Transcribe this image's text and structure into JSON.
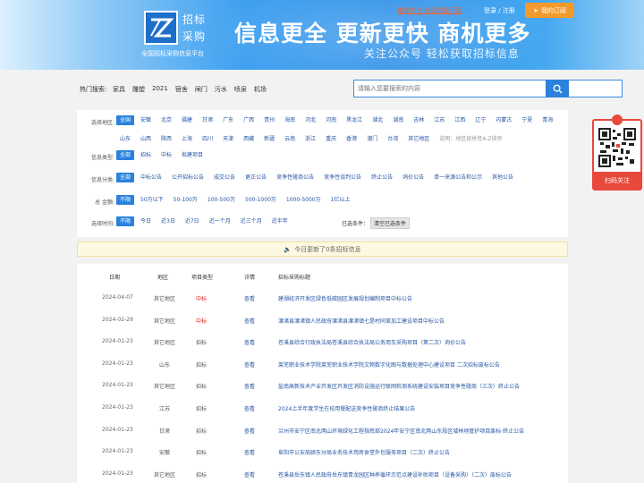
{
  "header": {
    "logo_line1": "招标",
    "logo_line2": "采购",
    "logo_sub": "全国招标采购信息平台",
    "headline": "信息更全  更新更快  商机更多",
    "subline": "关注公众号 轻松获取招标信息",
    "notice_link": "重点关注 全国招标订阅",
    "login": "登录 / 注册",
    "subscribe": "我的订阅",
    "colors": {
      "accent": "#2a82dd",
      "orange": "#f39a2c",
      "red": "#e02020"
    }
  },
  "search": {
    "hot_label": "热门搜索:",
    "hot_words": [
      "家具",
      "雕塑",
      "2021",
      "宿舍",
      "闸门",
      "污水",
      "喷泉",
      "机场"
    ],
    "placeholder": "请输入您要搜索的内容"
  },
  "filters": {
    "region": {
      "label": "选择地区:",
      "options": [
        "全国",
        "安徽",
        "北京",
        "福建",
        "甘肃",
        "广东",
        "广西",
        "贵州",
        "海南",
        "河北",
        "河南",
        "黑龙江",
        "湖北",
        "湖南",
        "吉林",
        "江苏",
        "江西",
        "辽宁",
        "内蒙古",
        "宁夏",
        "青海",
        "山东",
        "山西",
        "陕西",
        "上海",
        "四川",
        "天津",
        "西藏",
        "新疆",
        "云南",
        "浙江",
        "重庆",
        "香港",
        "澳门",
        "台湾",
        "其它地区"
      ],
      "note": "说明：地区按拼音A-Z排序"
    },
    "info_type": {
      "label": "信息类型:",
      "options": [
        "全部",
        "招标",
        "中标",
        "拟建项目"
      ]
    },
    "info_class": {
      "label": "信息分类:",
      "options": [
        "全部",
        "中标公告",
        "公开招标公告",
        "成交公告",
        "更正公告",
        "竞争性磋商公告",
        "竞争性谈判公告",
        "终止公告",
        "询价公告",
        "单一来源公告和公示",
        "其他公告"
      ]
    },
    "amount": {
      "label": "总 金额:",
      "options": [
        "不限",
        "50万以下",
        "50-100万",
        "100-500万",
        "500-1000万",
        "1000-5000万",
        "1亿以上"
      ]
    },
    "time": {
      "label": "选择时间:",
      "options": [
        "不限",
        "今日",
        "近3日",
        "近7日",
        "近一个月",
        "近三个月",
        "近半年"
      ]
    },
    "selected_label": "已选条件：",
    "clear": "清空已选条件"
  },
  "update_notice": "今日更新了0条招标信息",
  "table": {
    "headers": {
      "date": "日期",
      "area": "地区",
      "type": "项目类型",
      "detail": "详情",
      "title": "招标采购标题"
    },
    "rows": [
      {
        "date": "2024-04-07",
        "area": "其它地区",
        "type": "中标",
        "detail": "查看",
        "title": "建湖经济开发区绿色低碳园区发展规划编制项目中标公告"
      },
      {
        "date": "2024-02-29",
        "area": "其它地区",
        "type": "中标",
        "detail": "查看",
        "title": "溧渚县溧渚镇人民政府溧渚县溧渚镇七是村同草加工建设项目中标公告"
      },
      {
        "date": "2024-01-23",
        "area": "其它地区",
        "type": "招标",
        "detail": "查看",
        "title": "苍溪县综合行政执法局苍溪县综合执法局公务用车采购项目（第二次）询价公告"
      },
      {
        "date": "2024-01-23",
        "area": "山东",
        "type": "招标",
        "detail": "查看",
        "title": "莱芜职业技术学院莱芜职业技术学院文物数字化图与数据处理中心建设项目 二次招标废标公告"
      },
      {
        "date": "2024-01-23",
        "area": "其它地区",
        "type": "招标",
        "detail": "查看",
        "title": "盐南高新技术产业开发区开发区消防设施运行联网检测系统建设安装项目竞争性磋商（三次）终止公告"
      },
      {
        "date": "2024-01-23",
        "area": "江苏",
        "type": "招标",
        "detail": "查看",
        "title": "2024上半年度学生在校用餐配送竞争性磋商终止结果公告"
      },
      {
        "date": "2024-01-23",
        "area": "甘肃",
        "type": "招标",
        "detail": "查看",
        "title": "兰州市安宁区南北两山环境绿化工程指挥部2024年安宁区南北两山东段区域林地管护项目废标·终止公告"
      },
      {
        "date": "2024-01-23",
        "area": "安徽",
        "type": "招标",
        "detail": "查看",
        "title": "阜阳市公安局颍东分局业务技术用房食堂外包服务项目（二次）终止公告"
      },
      {
        "date": "2024-01-23",
        "area": "其它地区",
        "type": "招标",
        "detail": "查看",
        "title": "苍溪县岳东镇人民政府岳东镇青龙园区种养循环示范点建设补助项目（设备采购）（二次）废标公告"
      }
    ]
  },
  "qr": {
    "button": "扫码关注"
  }
}
